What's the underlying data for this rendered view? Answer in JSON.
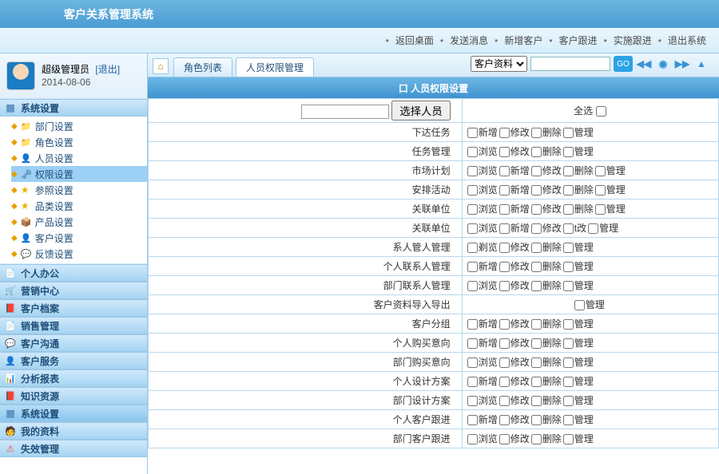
{
  "app_title": "客户关系管理系统",
  "top_menu": [
    "返回桌面",
    "发送消息",
    "新增客户",
    "客户跟进",
    "实施跟进",
    "退出系统"
  ],
  "user": {
    "name": "超级管理员",
    "exit": "[退出]",
    "date": "2014-08-06"
  },
  "side_header_main": "系统设置",
  "side_tree": [
    {
      "label": "部门设置",
      "icon": "ic-folder"
    },
    {
      "label": "角色设置",
      "icon": "ic-folder"
    },
    {
      "label": "人员设置",
      "icon": "ic-person"
    },
    {
      "label": "权限设置",
      "icon": "ic-key",
      "active": true
    },
    {
      "label": "参照设置",
      "icon": "ic-star"
    },
    {
      "label": "品类设置",
      "icon": "ic-star"
    },
    {
      "label": "产品设置",
      "icon": "ic-box"
    },
    {
      "label": "客户设置",
      "icon": "ic-person"
    },
    {
      "label": "反馈设置",
      "icon": "ic-chat"
    }
  ],
  "side_sections": [
    {
      "label": "个人办公",
      "icon": "ic-page"
    },
    {
      "label": "营销中心",
      "icon": "ic-cart"
    },
    {
      "label": "客户档案",
      "icon": "ic-book"
    },
    {
      "label": "销售管理",
      "icon": "ic-page"
    },
    {
      "label": "客户沟通",
      "icon": "ic-chat"
    },
    {
      "label": "客户服务",
      "icon": "ic-person"
    },
    {
      "label": "分析报表",
      "icon": "ic-bars"
    },
    {
      "label": "知识资源",
      "icon": "ic-book"
    },
    {
      "label": "系统设置",
      "icon": "ic-grid",
      "active": true
    },
    {
      "label": "我的资料",
      "icon": "ic-me"
    },
    {
      "label": "失效管理",
      "icon": "ic-fail"
    }
  ],
  "tabs": [
    {
      "label": "角色列表"
    },
    {
      "label": "人员权限管理",
      "active": true
    }
  ],
  "search": {
    "dropdown": "客户资料",
    "placeholder": ""
  },
  "perm_title": "口 人员权限设置",
  "select_person_btn": "选择人员",
  "select_all": "全选",
  "rows": [
    {
      "label": "下达任务",
      "ops": [
        "新增",
        "修改",
        "删除",
        "管理"
      ]
    },
    {
      "label": "任务管理",
      "ops": [
        "浏览",
        "修改",
        "删除",
        "管理"
      ]
    },
    {
      "label": "市场计划",
      "ops": [
        "浏览",
        "新增",
        "修改",
        "删除",
        "管理"
      ]
    },
    {
      "label": "安排活动",
      "ops": [
        "浏览",
        "新增",
        "修改",
        "删除",
        "管理"
      ]
    },
    {
      "label": "关联单位",
      "ops": [
        "浏览",
        "新增",
        "修改",
        "删除",
        "管理"
      ]
    },
    {
      "label": "关联单位",
      "ops": [
        "浏览",
        "新增",
        "修改",
        "t改",
        "管理"
      ]
    },
    {
      "label": "系人管人管理",
      "ops": [
        "剃览",
        "修改",
        "删除",
        "管理"
      ]
    },
    {
      "label": "个人联系人管理",
      "ops": [
        "新增",
        "修改",
        "删除",
        "管理"
      ]
    },
    {
      "label": "部门联系人管理",
      "ops": [
        "浏览",
        "修改",
        "删除",
        "管理"
      ]
    },
    {
      "label": "客户资料导入导出",
      "ops": [
        "管理"
      ]
    },
    {
      "label": "客户分组",
      "ops": [
        "新增",
        "修改",
        "删除",
        "管理"
      ]
    },
    {
      "label": "个人购买意向",
      "ops": [
        "新增",
        "修改",
        "删除",
        "管理"
      ]
    },
    {
      "label": "部门购买意向",
      "ops": [
        "浏览",
        "修改",
        "删除",
        "管理"
      ]
    },
    {
      "label": "个人设计方案",
      "ops": [
        "新增",
        "修改",
        "删除",
        "管理"
      ]
    },
    {
      "label": "部门设计方案",
      "ops": [
        "浏览",
        "修改",
        "删除",
        "管理"
      ]
    },
    {
      "label": "个人客户跟进",
      "ops": [
        "新增",
        "修改",
        "删除",
        "管理"
      ]
    },
    {
      "label": "部门客户跟进",
      "ops": [
        "浏览",
        "修改",
        "删除",
        "管理"
      ]
    }
  ]
}
